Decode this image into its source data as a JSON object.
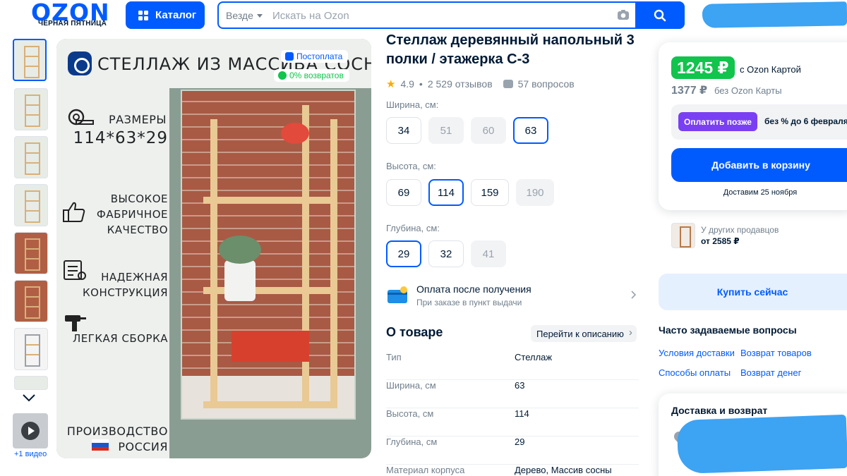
{
  "header": {
    "logo": "OZON",
    "logo_sub": "ЧЁРНАЯ ПЯТНИЦА",
    "catalog_label": "Каталог",
    "search_scope": "Везде",
    "search_placeholder": "Искать на Ozon"
  },
  "gallery": {
    "thumbnail_count": 8,
    "video_label": "+1 видео"
  },
  "main_image": {
    "headline": "СТЕЛЛАЖ ИЗ МАССИВА СОСНЫ",
    "chip_postoplata": "Постоплата",
    "chip_returns": "0% возвратов",
    "sizes_label": "РАЗМЕРЫ",
    "sizes_value": "114*63*29",
    "quality": [
      "ВЫСОКОЕ",
      "ФАБРИЧНОЕ",
      "КАЧЕСТВО"
    ],
    "construction": [
      "НАДЕЖНАЯ",
      "КОНСТРУКЦИЯ"
    ],
    "assembly": "ЛЕГКАЯ СБОРКА",
    "production": "ПРОИЗВОДСТВО",
    "country": "РОССИЯ"
  },
  "product": {
    "title": "Стеллаж деревянный напольный 3 полки / этажерка С-3",
    "rating": "4.9",
    "reviews": "2 529 отзывов",
    "questions": "57 вопросов",
    "width_label": "Ширина, см:",
    "width_options": [
      {
        "label": "34",
        "state": "normal"
      },
      {
        "label": "51",
        "state": "disabled"
      },
      {
        "label": "60",
        "state": "disabled"
      },
      {
        "label": "63",
        "state": "selected"
      }
    ],
    "height_label": "Высота, см:",
    "height_options": [
      {
        "label": "69",
        "state": "normal"
      },
      {
        "label": "114",
        "state": "selected"
      },
      {
        "label": "159",
        "state": "normal"
      },
      {
        "label": "190",
        "state": "disabled"
      }
    ],
    "depth_label": "Глубина, см:",
    "depth_options": [
      {
        "label": "29",
        "state": "selected"
      },
      {
        "label": "32",
        "state": "normal"
      },
      {
        "label": "41",
        "state": "disabled"
      }
    ],
    "payment_title": "Оплата после получения",
    "payment_sub": "При заказе в пункт выдачи",
    "about_title": "О товаре",
    "about_link": "Перейти к описанию",
    "specs": [
      {
        "k": "Тип",
        "v": "Стеллаж"
      },
      {
        "k": "Ширина, см",
        "v": "63"
      },
      {
        "k": "Высота, см",
        "v": "114"
      },
      {
        "k": "Глубина, см",
        "v": "29"
      },
      {
        "k": "Материал корпуса",
        "v": "Дерево, Массив сосны"
      }
    ]
  },
  "buy": {
    "price_card": "1245 ₽",
    "price_card_label": "с Ozon Картой",
    "price_regular": "1377 ₽",
    "price_regular_label": "без Ozon Карты",
    "pay_later_btn": "Оплатить позже",
    "pay_later_text": "без % до 6 февраля",
    "add_to_cart": "Добавить в корзину",
    "delivery_note": "Доставим 25 ноября",
    "other_sellers": "У других продавцов",
    "other_sellers_price": "от 2585 ₽",
    "buy_now": "Купить сейчас",
    "faq_title": "Часто задаваемые вопросы",
    "faq_links": [
      "Условия доставки",
      "Возврат товаров",
      "Способы оплаты",
      "Возврат денег"
    ],
    "shipping_title": "Доставка и возврат"
  },
  "colors": {
    "brand_blue": "#005bff",
    "price_green": "#10c44c",
    "pay_later_purple": "#7a3ff2",
    "rating_star": "#ffa800"
  }
}
